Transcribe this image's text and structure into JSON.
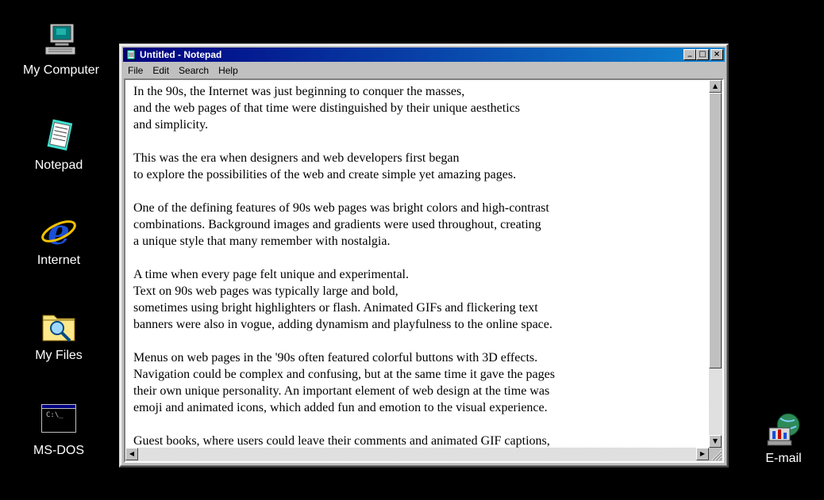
{
  "desktop": {
    "icons": [
      {
        "label": "My Computer",
        "icon": "computer-icon"
      },
      {
        "label": "Notepad",
        "icon": "notepad-icon"
      },
      {
        "label": "Internet",
        "icon": "internet-explorer-icon"
      },
      {
        "label": "My Files",
        "icon": "folder-search-icon"
      },
      {
        "label": "MS-DOS",
        "icon": "ms-dos-icon"
      },
      {
        "label": "E-mail",
        "icon": "email-icon"
      }
    ],
    "msdos_prompt": "C:\\_"
  },
  "window": {
    "title": "Untitled - Notepad",
    "menu": [
      "File",
      "Edit",
      "Search",
      "Help"
    ],
    "buttons": {
      "minimize": "_",
      "maximize": "□",
      "close": "×"
    },
    "text": "In the 90s, the Internet was just beginning to conquer the masses,\nand the web pages of that time were distinguished by their unique aesthetics\nand simplicity.\n\nThis was the era when designers and web developers first began\nto explore the possibilities of the web and create simple yet amazing pages.\n\nOne of the defining features of 90s web pages was bright colors and high-contrast\ncombinations. Background images and gradients were used throughout, creating\na unique style that many remember with nostalgia.\n\nA time when every page felt unique and experimental.\nText on 90s web pages was typically large and bold,\nsometimes using bright highlighters or flash. Animated GIFs and flickering text\nbanners were also in vogue, adding dynamism and playfulness to the online space.\n\nMenus on web pages in the '90s often featured colorful buttons with 3D effects.\nNavigation could be complex and confusing, but at the same time it gave the pages\ntheir own unique personality. An important element of web design at the time was\nemoji and animated icons, which added fun and emotion to the visual experience.\n\nGuest books, where users could leave their comments and animated GIF captions,"
  },
  "colors": {
    "desktop": "#000000",
    "title_start": "#000080",
    "title_end": "#1084d0",
    "chrome": "#c0c0c0"
  }
}
